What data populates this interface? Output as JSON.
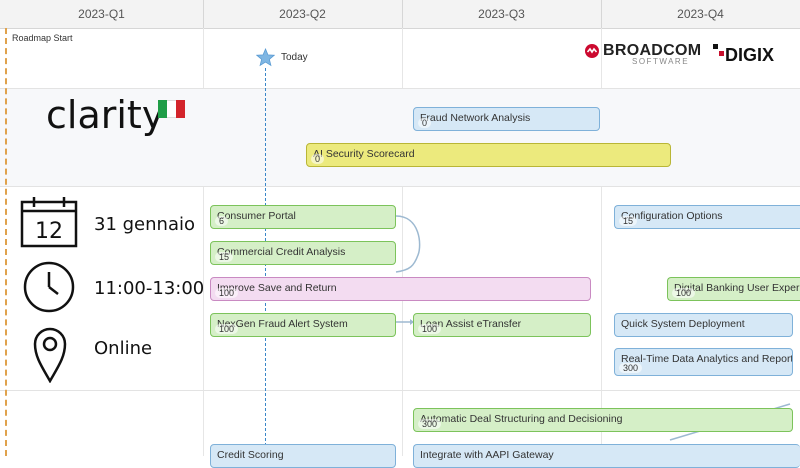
{
  "quarters": [
    "2023-Q1",
    "2023-Q2",
    "2023-Q3",
    "2023-Q4"
  ],
  "markers": {
    "roadmap_start": "Roadmap Start",
    "today": "Today"
  },
  "logos": {
    "clarity": "clarity",
    "broadcom": "BROADCOM",
    "broadcom_sub": "SOFTWARE",
    "digix": "DIGIX"
  },
  "event": {
    "date": "31 gennaio",
    "time": "11:00-13:00",
    "place": "Online"
  },
  "bars": {
    "fraud_network": {
      "label": "Fraud Network Analysis",
      "count": "0"
    },
    "ai_security": {
      "label": "AI Security Scorecard",
      "count": "0"
    },
    "consumer_portal": {
      "label": "Consumer Portal",
      "count": "6"
    },
    "commercial_credit": {
      "label": "Commercial Credit Analysis",
      "count": "15"
    },
    "improve_save": {
      "label": "Improve Save and Return",
      "count": "100"
    },
    "nexgen_fraud": {
      "label": "NexGen Fraud Alert System",
      "count": "100"
    },
    "loan_assist": {
      "label": "Loan Assist eTransfer",
      "count": "100"
    },
    "config_options": {
      "label": "Configuration Options",
      "count": "15"
    },
    "digital_banking": {
      "label": "Digital Banking User Experien",
      "count": "100"
    },
    "quick_deploy": {
      "label": "Quick System Deployment",
      "count": ""
    },
    "realtime_data": {
      "label": "Real-Time Data Analytics and Reporting",
      "count": "300"
    },
    "auto_deal": {
      "label": "Automatic Deal Structuring and Decisioning",
      "count": "300"
    },
    "credit_scoring": {
      "label": "Credit Scoring",
      "count": ""
    },
    "aapi_gateway": {
      "label": "Integrate with AAPI Gateway",
      "count": ""
    }
  },
  "colors": {
    "green": "#d5efc7",
    "blue": "#d6e8f6",
    "yellow": "#ecea7d",
    "pink": "#f3dcf1",
    "today_line": "#3a86c8",
    "start_line": "#e0a24c",
    "italy_green": "#1f9d47",
    "italy_red": "#d3242b",
    "broadcom_red": "#cc092f"
  }
}
